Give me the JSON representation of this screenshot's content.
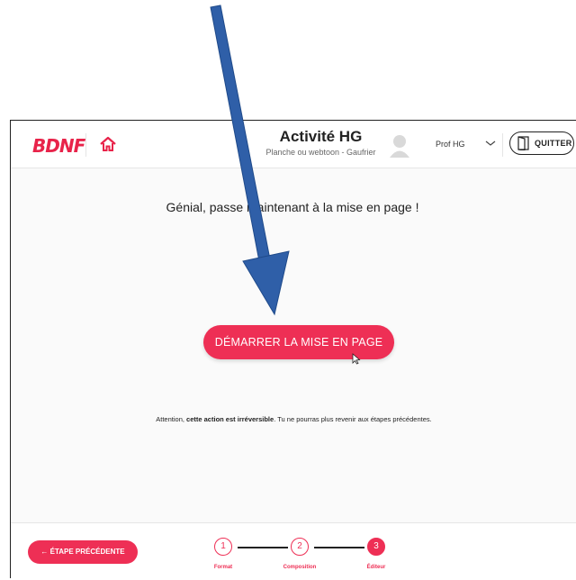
{
  "header": {
    "logo": "BDNF",
    "title": "Activité HG",
    "subtitle": "Planche ou webtoon - Gaufrier",
    "user": "Prof HG",
    "quit_label": "QUITTER"
  },
  "main": {
    "message": "Génial, passe maintenant à la mise en page !",
    "start_button": "DÉMARRER LA MISE EN PAGE",
    "warning_prefix": "Attention, ",
    "warning_bold": "cette action est irréversible",
    "warning_suffix": ". Tu ne pourras plus revenir aux étapes précédentes."
  },
  "footer": {
    "prev_label": "← ÉTAPE PRÉCÉDENTE",
    "steps": [
      {
        "number": "1",
        "label": "Format"
      },
      {
        "number": "2",
        "label": "Composition"
      },
      {
        "number": "3",
        "label": "Éditeur"
      }
    ]
  },
  "colors": {
    "accent": "#ee2f55",
    "annotation_arrow": "#2f5fa8"
  }
}
